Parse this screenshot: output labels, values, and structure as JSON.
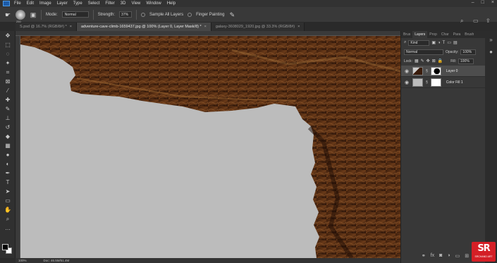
{
  "menubar": {
    "items": [
      "File",
      "Edit",
      "Image",
      "Layer",
      "Type",
      "Select",
      "Filter",
      "3D",
      "View",
      "Window",
      "Help"
    ]
  },
  "options": {
    "brush_size": "250",
    "mode_label": "Mode:",
    "mode_value": "Normal",
    "strength_label": "Strength:",
    "strength_value": "37%",
    "sample_all_layers": "Sample All Layers",
    "finger_painting": "Finger Painting"
  },
  "tabs": [
    {
      "label": "S.psd @ 16.7% (RGB/8#) *",
      "close": "×"
    },
    {
      "label": "adventure-cave-climb-1659437.jpg @ 100% (Layer 0, Layer Mask/8) *",
      "close": "×"
    },
    {
      "label": "galaxy-3608029_1920.jpg @ 33.3% (RGB/8#)",
      "close": "×"
    }
  ],
  "status": {
    "zoom": "100%",
    "doc": "Doc: 46.5M/51.4M"
  },
  "panel": {
    "tabs": [
      "Brus",
      "Layers",
      "Prop",
      "Char",
      "Para",
      "Brush"
    ],
    "kind": "Kind",
    "blend_mode": "Normal",
    "opacity_label": "Opacity:",
    "opacity_value": "100%",
    "lock_label": "Lock:",
    "fill_label": "Fill:",
    "fill_value": "100%",
    "layers": [
      {
        "name": "Layer 0"
      },
      {
        "name": "Color Fill 1"
      }
    ]
  },
  "watermark": {
    "logo": "SR",
    "text": "SRCHAND ART"
  },
  "colors": {
    "canvas_bg": "#bcbcbc",
    "rock_dark": "#2a140a",
    "rock_mid": "#5a3014",
    "rock_light": "#8a5528",
    "accent_red": "#d41f26"
  },
  "icons": {
    "eye": "eye-icon",
    "close": "close-icon",
    "brush": "brush-icon"
  }
}
